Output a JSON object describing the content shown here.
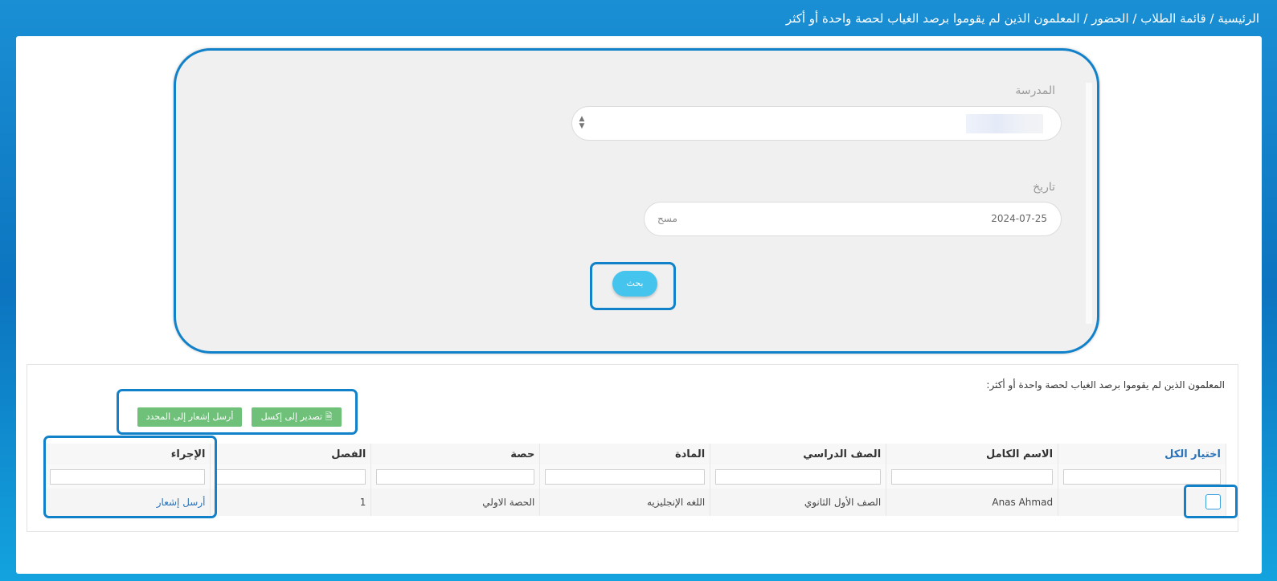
{
  "breadcrumb": {
    "home": "الرئيسية",
    "students_list": "قائمة الطلاب",
    "attendance": "الحضور",
    "current": "المعلمون الذين لم يقوموا برصد الغياب لحصة واحدة أو أكثر",
    "separator": " / "
  },
  "filters": {
    "school_label": "المدرسة",
    "date_label": "تاريخ",
    "date_value": "2024-07-25",
    "clear_label": "مسح",
    "search_button": "بحث"
  },
  "results": {
    "title": "المعلمون الذين لم يقوموا برصد الغياب لحصة واحدة أو أكثر:",
    "export_button": "تصدير إلى إكسل",
    "notify_selected_button": "أرسل إشعار إلى المحدد",
    "columns": {
      "select_all": "اختيار الكل",
      "full_name": "الاسم الكامل",
      "grade": "الصف الدراسي",
      "subject": "المادة",
      "period": "حصة",
      "class": "الفصل",
      "action": "الإجراء"
    },
    "rows": [
      {
        "full_name": "Anas Ahmad",
        "grade": "الصف الأول الثانوي",
        "subject": "اللغه الإنجليزيه",
        "period": "الحصة الاولي",
        "class": "1",
        "action": "أرسل إشعار"
      }
    ]
  },
  "icons": {
    "excel": "excel-file-icon",
    "select_arrows": "sort-arrows-icon"
  },
  "colors": {
    "header_blue": "#1181c9",
    "search_button": "#45c4ee",
    "green_button": "#6fc17a",
    "link": "#2b73b8"
  }
}
